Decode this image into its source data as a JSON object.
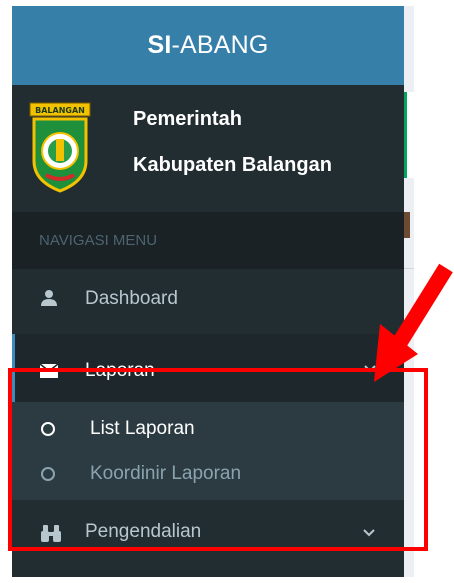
{
  "brand": {
    "bold": "SI",
    "rest": "-ABANG"
  },
  "user_panel": {
    "line1": "Pemerintah",
    "line2": "Kabupaten Balangan",
    "logo_text": "BALANGAN"
  },
  "menu": {
    "header": "NAVIGASI MENU",
    "dashboard": {
      "label": "Dashboard",
      "icon": "user-icon"
    },
    "laporan": {
      "label": "Laporan",
      "icon": "envelope-icon",
      "expanded": true
    },
    "submenu": [
      {
        "label": "List Laporan",
        "active": true
      },
      {
        "label": "Koordinir Laporan",
        "active": false
      }
    ],
    "pengendalian": {
      "label": "Pengendalian",
      "icon": "binoculars-icon"
    }
  },
  "colors": {
    "brand_bg": "#367fa9",
    "sidebar_bg": "#222d32",
    "submenu_bg": "#2c3b41",
    "active_border": "#3c8dbc",
    "annotation": "#ff0000"
  }
}
